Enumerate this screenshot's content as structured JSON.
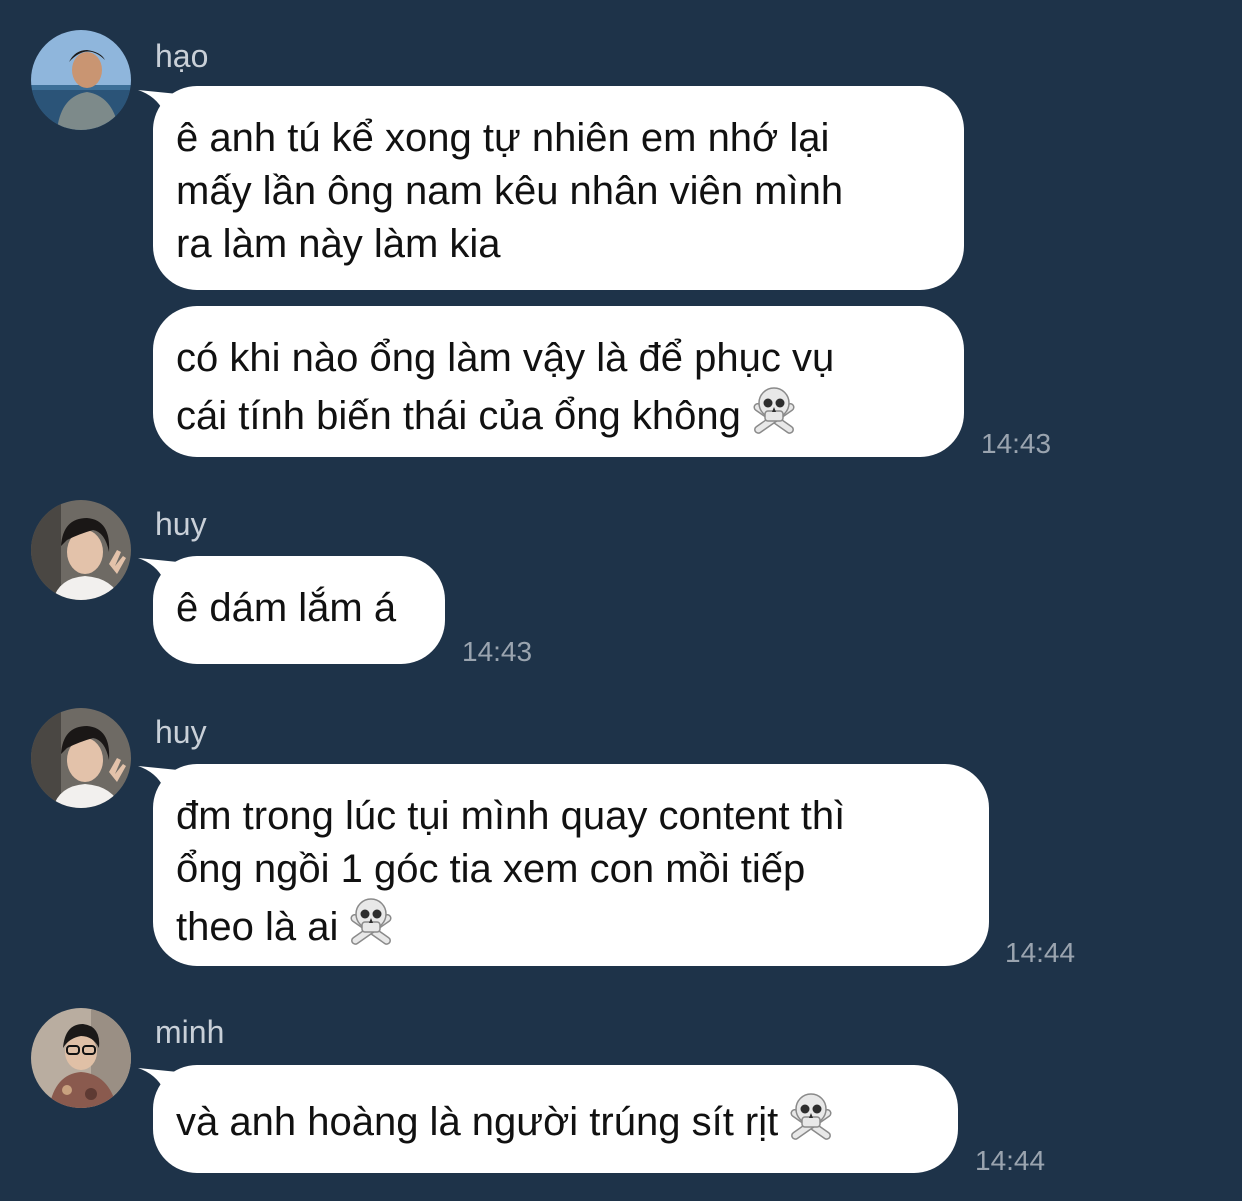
{
  "messages": [
    {
      "sender": "hạo",
      "bubbles": [
        {
          "lines": [
            "ê anh tú kể xong tự nhiên em nhớ lại",
            "mấy lần ông nam kêu nhân viên mình",
            "ra làm này làm kia"
          ]
        },
        {
          "lines": [
            "có khi nào ổng làm vậy là để phục vụ",
            "cái tính biến thái của ổng không"
          ],
          "emoji": "skull-emoji"
        }
      ],
      "time": "14:43"
    },
    {
      "sender": "huy",
      "bubbles": [
        {
          "lines": [
            "ê dám lắm á"
          ]
        }
      ],
      "time": "14:43"
    },
    {
      "sender": "huy",
      "bubbles": [
        {
          "lines": [
            "đm trong lúc tụi mình quay content thì",
            "ổng ngồi 1 góc tia xem con mồi tiếp",
            "theo là ai"
          ],
          "emoji": "skull-emoji"
        }
      ],
      "time": "14:44"
    },
    {
      "sender": "minh",
      "bubbles": [
        {
          "lines": [
            "và anh hoàng là người trúng sít rịt"
          ],
          "emoji": "skull-emoji"
        }
      ],
      "time": "14:44"
    }
  ],
  "colors": {
    "background": "#1e3349",
    "bubble": "#ffffff",
    "sender_text": "#c9d0d8",
    "time_text": "#9aa4af"
  }
}
